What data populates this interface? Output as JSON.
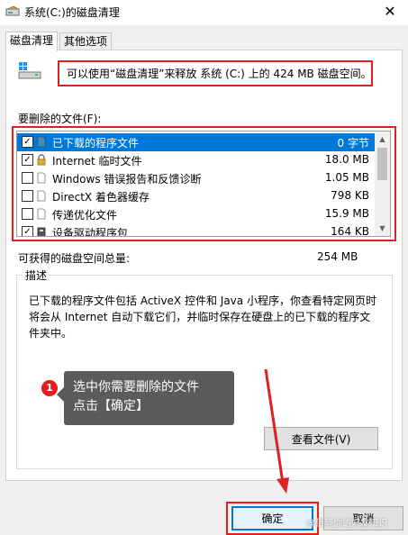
{
  "window": {
    "title": "系统(C:)的磁盘清理"
  },
  "tabs": [
    {
      "label": "磁盘清理"
    },
    {
      "label": "其他选项"
    }
  ],
  "summary": {
    "text": "可以使用“磁盘清理”来释放 系统 (C:) 上的 424 MB 磁盘空间。"
  },
  "files": {
    "label": "要删除的文件(F):",
    "items": [
      {
        "checked": true,
        "icon": "file-icon",
        "name": "已下载的程序文件",
        "size": "0 字节"
      },
      {
        "checked": true,
        "icon": "lock-icon",
        "name": "Internet 临时文件",
        "size": "18.0 MB"
      },
      {
        "checked": false,
        "icon": "file-icon",
        "name": "Windows 错误报告和反馈诊断",
        "size": "1.05 MB"
      },
      {
        "checked": false,
        "icon": "file-icon",
        "name": "DirectX 着色器缓存",
        "size": "798 KB"
      },
      {
        "checked": false,
        "icon": "file-icon",
        "name": "传递优化文件",
        "size": "15.9 MB"
      },
      {
        "checked": true,
        "icon": "package-icon",
        "name": "设备驱动程序包",
        "size": "164 KB"
      }
    ]
  },
  "total": {
    "label": "可获得的磁盘空间总量:",
    "value": "254 MB"
  },
  "description": {
    "title": "描述",
    "text": "已下载的程序文件包括 ActiveX 控件和 Java 小程序，你查看特定网页时将会从 Internet 自动下载它们，并临时保存在硬盘上的已下载的程序文件夹中。"
  },
  "buttons": {
    "view_files": "查看文件(V)",
    "ok": "确定",
    "cancel": "取消"
  },
  "annotation": {
    "step": "1",
    "line1": "选中你需要删除的文件",
    "line2": "点击【确定】"
  },
  "watermark": "@佰晓你的好友知识",
  "colors": {
    "highlight": "#e02020",
    "selection": "#0078d7",
    "tooltip": "#5b5b5b"
  }
}
